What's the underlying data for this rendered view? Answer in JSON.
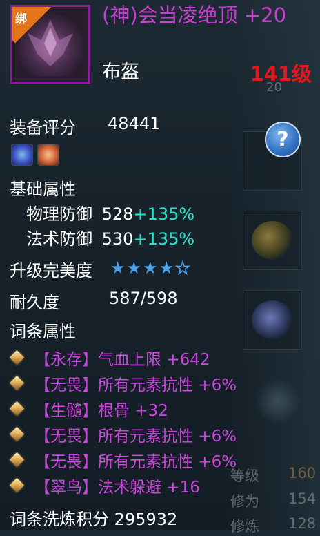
{
  "item": {
    "bind_label": "绑",
    "name": "(神)会当凌绝顶 +20",
    "type": "布盔",
    "level": "141级"
  },
  "score": {
    "label": "装备评分",
    "value": "48441"
  },
  "base": {
    "heading": "基础属性",
    "physical": {
      "label": "物理防御",
      "value": "528",
      "bonus": "+135%"
    },
    "magic": {
      "label": "法术防御",
      "value": "530",
      "bonus": "+135%"
    }
  },
  "perfection": {
    "label": "升级完美度",
    "stars_filled": 4,
    "stars_total": 5
  },
  "durability": {
    "label": "耐久度",
    "value": "587/598"
  },
  "affixes": {
    "heading": "词条属性",
    "items": [
      {
        "tag": "【永存】",
        "text": "气血上限 +642"
      },
      {
        "tag": "【无畏】",
        "text": "所有元素抗性 +6%"
      },
      {
        "tag": "【生髓】",
        "text": "根骨 +32"
      },
      {
        "tag": "【无畏】",
        "text": "所有元素抗性 +6%"
      },
      {
        "tag": "【无畏】",
        "text": "所有元素抗性 +6%"
      },
      {
        "tag": "【翠鸟】",
        "text": "法术躲避 +16"
      }
    ]
  },
  "refine": {
    "label": "词条洗炼积分",
    "value": "295932"
  },
  "background": {
    "level_label": "等级",
    "level_value": "160",
    "cultivation_label": "修为",
    "cultivation_value": "154",
    "bottom_label": "修炼",
    "bottom_value": "128",
    "top_number": "20"
  },
  "colors": {
    "rarity": "#c83fd2",
    "level": "#e5151b",
    "bonus": "#24e2c8",
    "affix": "#c646d8"
  }
}
